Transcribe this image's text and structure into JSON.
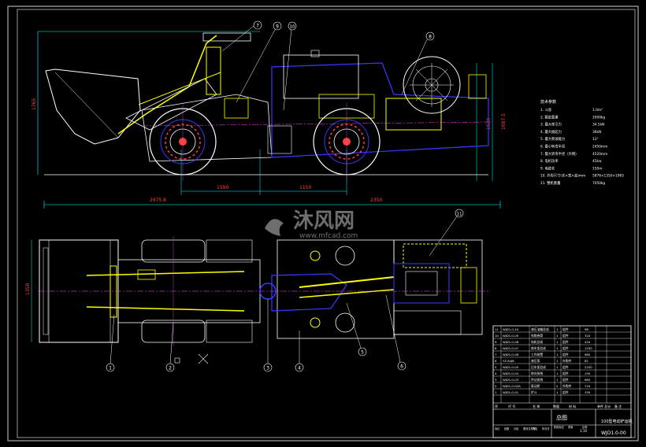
{
  "watermark": {
    "brand": "沐风网",
    "url": "www.mfcad.com"
  },
  "dimensions": {
    "overall_length": "2975.8",
    "wheelbase_left": "1590",
    "wheelbase_right": "1150",
    "rear_overhang": "2350",
    "left_height": "1765",
    "right_height_a": "1620",
    "right_height_b": "1687.5",
    "top_view_width": "1350"
  },
  "balloons": {
    "side": [
      "7",
      "9",
      "10",
      "8"
    ],
    "top": [
      "1",
      "2",
      "3",
      "4",
      "5",
      "6",
      "11"
    ]
  },
  "specs": {
    "title": "技术参数",
    "rows": [
      {
        "label": "1. 斗容",
        "value": "1.0m³"
      },
      {
        "label": "2. 额定载重",
        "value": "2000kg"
      },
      {
        "label": "3. 最大牵引力",
        "value": "34.5kN"
      },
      {
        "label": "4. 最大掘起力",
        "value": "36kN"
      },
      {
        "label": "5. 最大爬坡能力",
        "value": "12°"
      },
      {
        "label": "6. 最小转弯半径",
        "value": "2450mm"
      },
      {
        "label": "7. 最大转弯半径（外侧）",
        "value": "4520mm"
      },
      {
        "label": "8. 电机功率",
        "value": "45kw"
      },
      {
        "label": "9. 电缆长",
        "value": "150m"
      },
      {
        "label": "10. 外形尺寸(长×宽×高)mm",
        "value": "5876×1350×1965"
      },
      {
        "label": "11. 整机重量",
        "value": "7050kg"
      }
    ]
  },
  "title_block": {
    "parts": [
      {
        "no": "11",
        "code": "WJD1.0-10",
        "name": "液压油箱总成",
        "qty": "1",
        "mat": "组件",
        "wt": "98"
      },
      {
        "no": "10",
        "code": "WJD1.0-09",
        "name": "电缆卷筒",
        "qty": "1",
        "mat": "组件",
        "wt": "320"
      },
      {
        "no": "9",
        "code": "WJD1.0-08",
        "name": "电机总成",
        "qty": "1",
        "mat": "组件",
        "wt": "420"
      },
      {
        "no": "8",
        "code": "WJD1.0-07",
        "name": "前车架总成",
        "qty": "1",
        "mat": "组件",
        "wt": "1250"
      },
      {
        "no": "7",
        "code": "WJD1.0-06",
        "name": "工作装置",
        "qty": "1",
        "mat": "组件",
        "wt": "980"
      },
      {
        "no": "6",
        "code": "YZ-84JB",
        "name": "液压泵",
        "qty": "1",
        "mat": "外购件",
        "wt": "82"
      },
      {
        "no": "5",
        "code": "WJD1.0-05",
        "name": "后车架总成",
        "qty": "1",
        "mat": "组件",
        "wt": "2200"
      },
      {
        "no": "4",
        "code": "WJD1.0-04",
        "name": "转向系统",
        "qty": "1",
        "mat": "组件",
        "wt": "150"
      },
      {
        "no": "3",
        "code": "WJD1.0-03",
        "name": "传动系统",
        "qty": "1",
        "mat": "组件",
        "wt": "680"
      },
      {
        "no": "2",
        "code": "WJD1.0-02A",
        "name": "驱动桥",
        "qty": "2",
        "mat": "外购件",
        "wt": "720"
      },
      {
        "no": "1",
        "code": "WJD1.0-01",
        "name": "铲斗",
        "qty": "1",
        "mat": "组件",
        "wt": "330"
      }
    ],
    "header": [
      "序",
      "代 号",
      "名 称",
      "数量",
      "材 料",
      "单件 总计",
      "备 注"
    ],
    "drawing_name": "总图",
    "product_name": "100型电动铲运机",
    "drawing_no": "WJD1.0-00",
    "sign_labels": [
      "标记",
      "处数",
      "分区",
      "更改文件号",
      "签名",
      "年月日"
    ],
    "stage_labels": [
      "阶段标记",
      "重量",
      "比例"
    ],
    "scale": "1:10"
  },
  "colors": {
    "frame": "#ffffff",
    "body": "#3a3aff",
    "accent": "#ffff00",
    "dim": "#00ffff",
    "center": "#ff40ff",
    "wheel": "#ffffff",
    "watermark": "#8a8a8a"
  }
}
